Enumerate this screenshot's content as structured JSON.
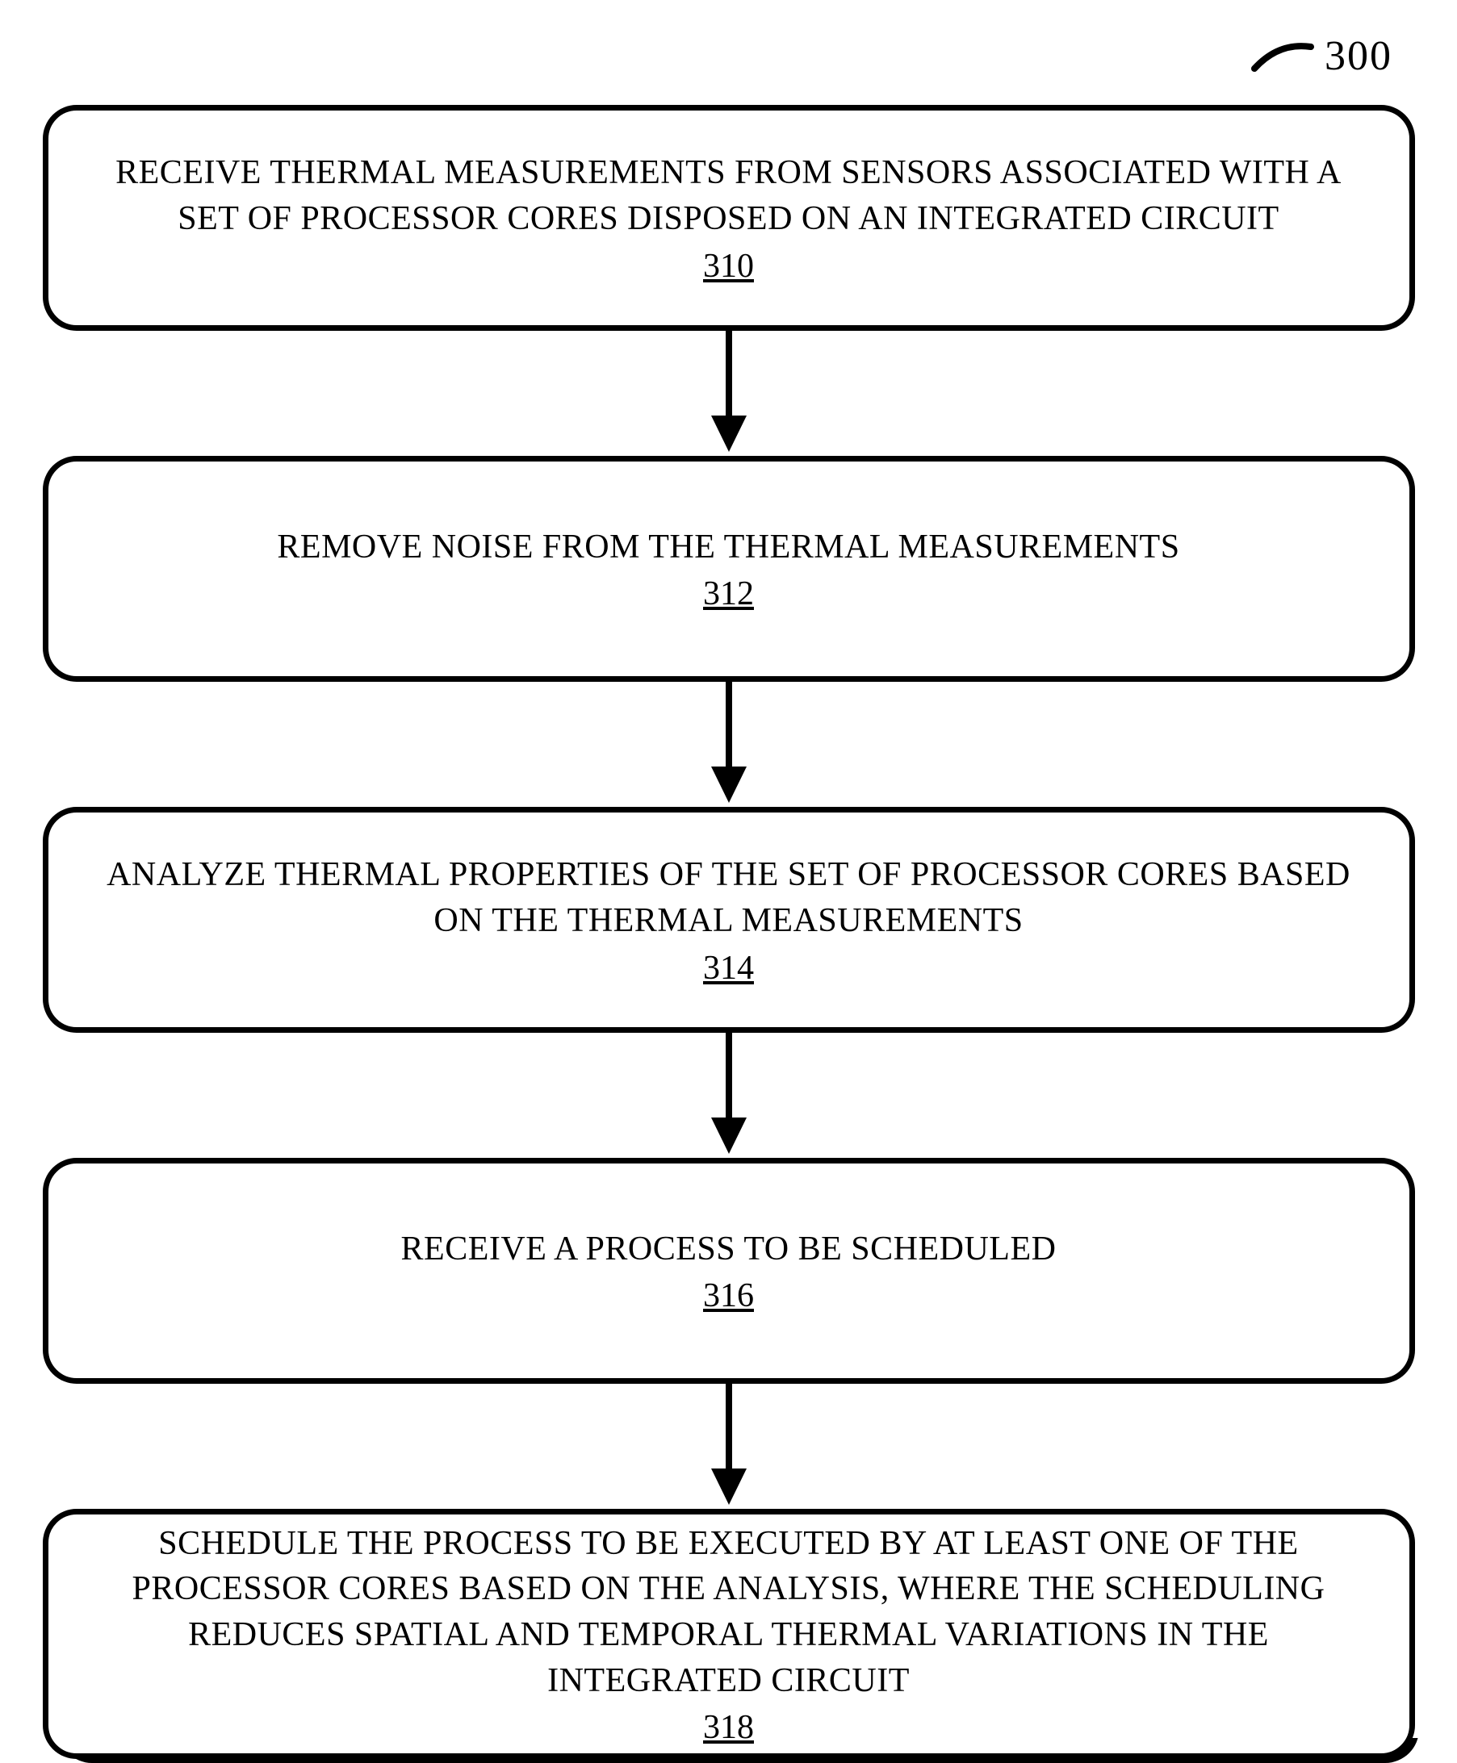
{
  "figure_ref": "300",
  "steps": [
    {
      "text": "RECEIVE THERMAL MEASUREMENTS FROM SENSORS ASSOCIATED WITH A SET OF PROCESSOR CORES DISPOSED ON AN INTEGRATED CIRCUIT",
      "ref": "310"
    },
    {
      "text": "REMOVE NOISE FROM THE THERMAL MEASUREMENTS",
      "ref": "312"
    },
    {
      "text": "ANALYZE THERMAL PROPERTIES OF THE SET OF PROCESSOR CORES BASED ON THE THERMAL MEASUREMENTS",
      "ref": "314"
    },
    {
      "text": "RECEIVE A PROCESS TO BE SCHEDULED",
      "ref": "316"
    },
    {
      "text": "SCHEDULE THE PROCESS TO BE EXECUTED BY AT LEAST ONE OF THE PROCESSOR CORES BASED ON THE ANALYSIS, WHERE THE SCHEDULING REDUCES SPATIAL AND TEMPORAL THERMAL VARIATIONS IN THE INTEGRATED CIRCUIT",
      "ref": "318"
    }
  ]
}
